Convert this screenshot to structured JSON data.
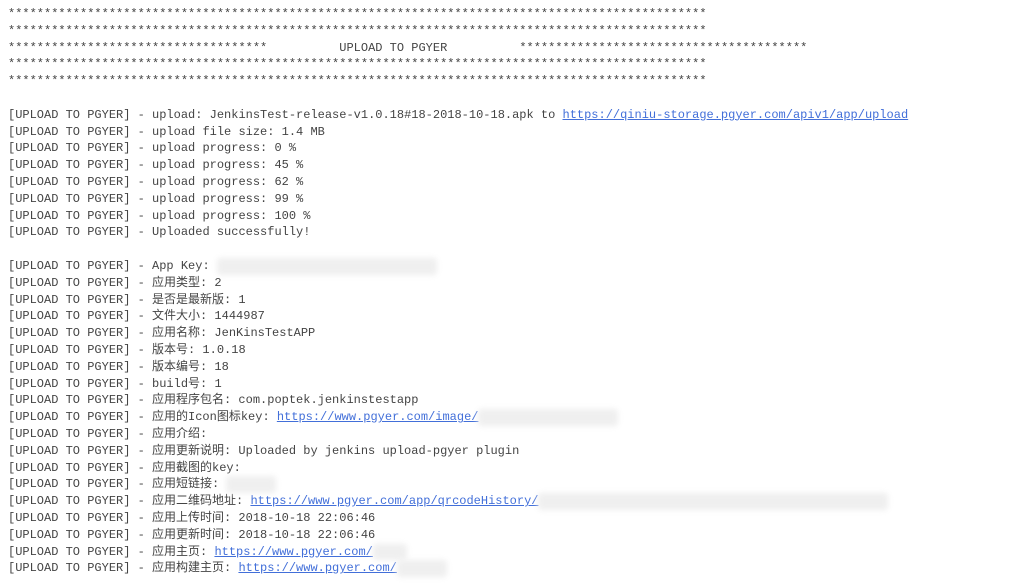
{
  "banner": {
    "star_row": "*************************************************************************************************",
    "row2a": "************************************",
    "title": "UPLOAD TO PGYER",
    "row2b": "****************************************"
  },
  "prefix": "[UPLOAD TO PGYER] - ",
  "lines": {
    "l1_label": "upload: JenkinsTest-release-v1.0.18#18-2018-10-18.apk to ",
    "l1_url": "https://qiniu-storage.pgyer.com/apiv1/app/upload",
    "l2": "upload file size: 1.4 MB",
    "l3": "upload progress: 0 %",
    "l4": "upload progress: 45 %",
    "l5": "upload progress: 62 %",
    "l6": "upload progress: 99 %",
    "l7": "upload progress: 100 %",
    "l8": "Uploaded successfully!",
    "l9": "App Key: ",
    "l10": "应用类型: 2",
    "l11": "是否是最新版: 1",
    "l12": "文件大小: 1444987",
    "l13": "应用名称: JenKinsTestAPP",
    "l14": "版本号: 1.0.18",
    "l15": "版本编号: 18",
    "l16": "build号: 1",
    "l17": "应用程序包名: com.poptek.jenkinstestapp",
    "l18_label": "应用的Icon图标key: ",
    "l18_url": "https://www.pgyer.com/image/",
    "l19": "应用介绍:",
    "l20": "应用更新说明: Uploaded by jenkins upload-pgyer plugin",
    "l21": "应用截图的key:",
    "l22": "应用短链接: ",
    "l23_label": "应用二维码地址: ",
    "l23_url": "https://www.pgyer.com/app/qrcodeHistory/",
    "l24": "应用上传时间: 2018-10-18 22:06:46",
    "l25": "应用更新时间: 2018-10-18 22:06:46",
    "l26_label": "应用主页: ",
    "l26_url": "https://www.pgyer.com/",
    "l27_label": "应用构建主页: ",
    "l27_url": "https://www.pgyer.com/"
  }
}
